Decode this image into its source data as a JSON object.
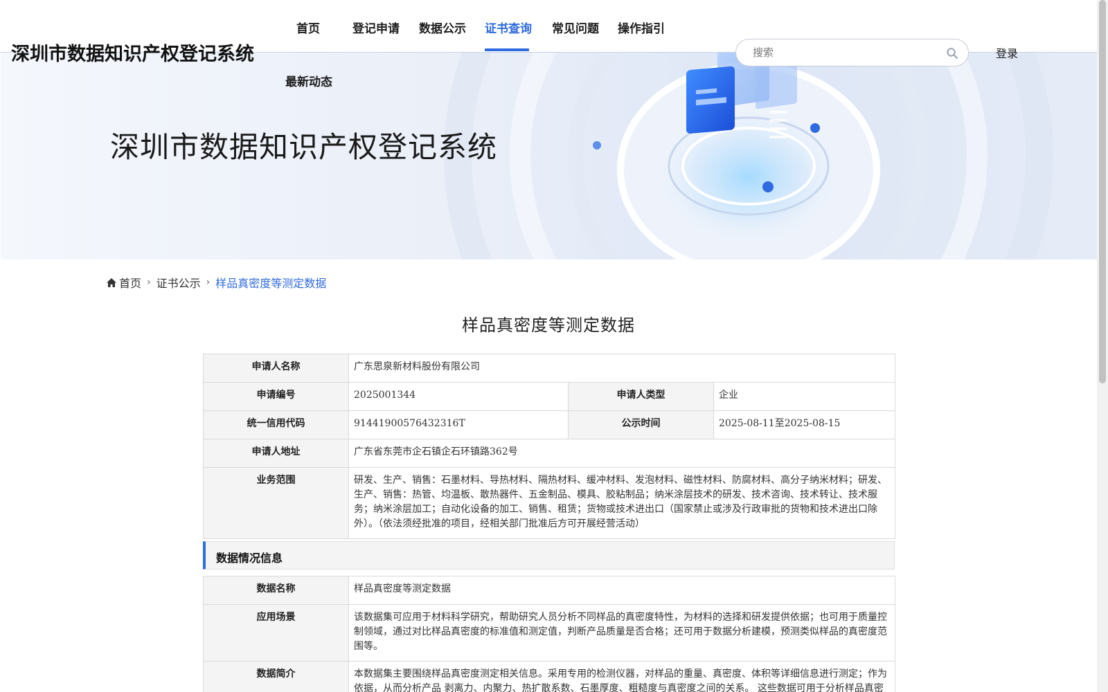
{
  "header": {
    "site_title": "深圳市数据知识产权登记系统",
    "nav": [
      {
        "label": "首页"
      },
      {
        "label": "登记申请"
      },
      {
        "label": "数据公示"
      },
      {
        "label": "证书查询"
      },
      {
        "label": "常见问题"
      },
      {
        "label": "操作指引"
      },
      {
        "label": "最新动态"
      }
    ],
    "active_nav": "证书查询",
    "search_placeholder": "搜索",
    "login_label": "登录"
  },
  "hero": {
    "title": "深圳市数据知识产权登记系统"
  },
  "breadcrumb": {
    "items": [
      "首页",
      "证书公示",
      "样品真密度等测定数据"
    ]
  },
  "page_title": "样品真密度等测定数据",
  "applicant": {
    "name_label": "申请人名称",
    "name": "广东思泉新材料股份有限公司",
    "number_label": "申请编号",
    "number": "2025001344",
    "type_label": "申请人类型",
    "type": "企业",
    "credit_code_label": "统一信用代码",
    "credit_code": "91441900576432316T",
    "publicity_time_label": "公示时间",
    "publicity_time": "2025-08-11至2025-08-15",
    "address_label": "申请人地址",
    "address": "广东省东莞市企石镇企石环镇路362号",
    "scope_label": "业务范围",
    "scope": "研发、生产、销售：石墨材料、导热材料、隔热材料、缓冲材料、发泡材料、磁性材料、防腐材料、高分子纳米材料；研发、生产、销售：热管、均温板、散热器件、五金制品、模具、胶粘制品；纳米涂层技术的研发、技术咨询、技术转让、技术服务；纳米涂层加工；自动化设备的加工、销售、租赁；货物或技术进出口（国家禁止或涉及行政审批的货物和技术进出口除外）。（依法须经批准的项目，经相关部门批准后方可开展经营活动）"
  },
  "data_section": {
    "title": "数据情况信息",
    "data_name_label": "数据名称",
    "data_name": "样品真密度等测定数据",
    "scenario_label": "应用场景",
    "scenario": "该数据集可应用于材料科学研究，帮助研究人员分析不同样品的真密度特性，为材料的选择和研发提供依据；也可用于质量控制领域，通过对比样品真密度的标准值和测定值，判断产品质量是否合格；还可用于数据分析建模，预测类似样品的真密度范围等。",
    "intro_label": "数据简介",
    "intro": "本数据集主要围绕样品真密度测定相关信息。采用专用的检测仪器，对样品的重量、真密度、体积等详细信息进行测定；作为依据，从而分析产品 剥离力、内聚力、热扩散系数、石墨厚度、粗糙度与真密度之间的关系。 这些数据可用于分析样品真密度的分布规律、探究不同样品特性与真密度的关系等，为相关研究和生产提供数据支撑。数据来源于实际的样品真密度测定工"
  },
  "colors": {
    "accent": "#2f6be0",
    "label_bg": "#f4f4f4",
    "border": "#d9d9d9"
  },
  "icons": {
    "search": "search-icon",
    "home": "home-icon",
    "separator": "chevron-right-icon"
  }
}
